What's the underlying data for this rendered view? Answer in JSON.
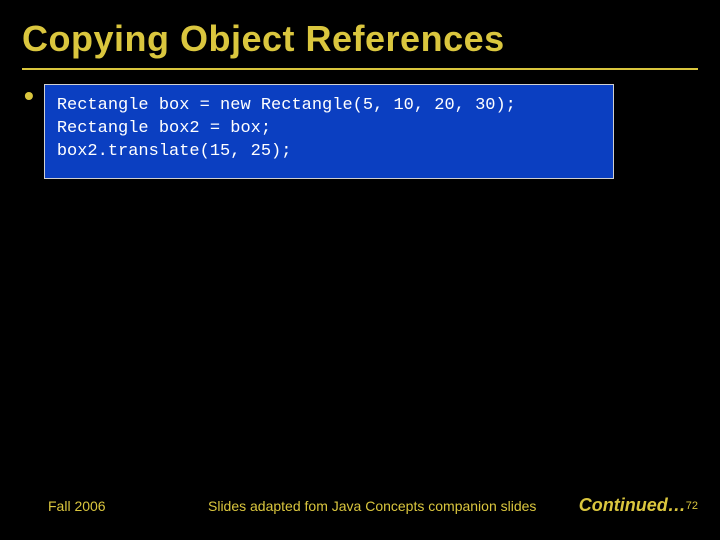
{
  "slide": {
    "title": "Copying Object References",
    "bullet_glyph": "•",
    "code": "Rectangle box = new Rectangle(5, 10, 20, 30);\nRectangle box2 = box;\nbox2.translate(15, 25);"
  },
  "footer": {
    "left": "Fall 2006",
    "center": "Slides adapted fom Java Concepts companion slides",
    "continued": "Continued…",
    "page_number": "72"
  },
  "colors": {
    "background": "#000000",
    "accent": "#dac63e",
    "code_bg": "#0b3fc1",
    "code_border": "#d0d0d0",
    "code_text": "#ffffff"
  }
}
